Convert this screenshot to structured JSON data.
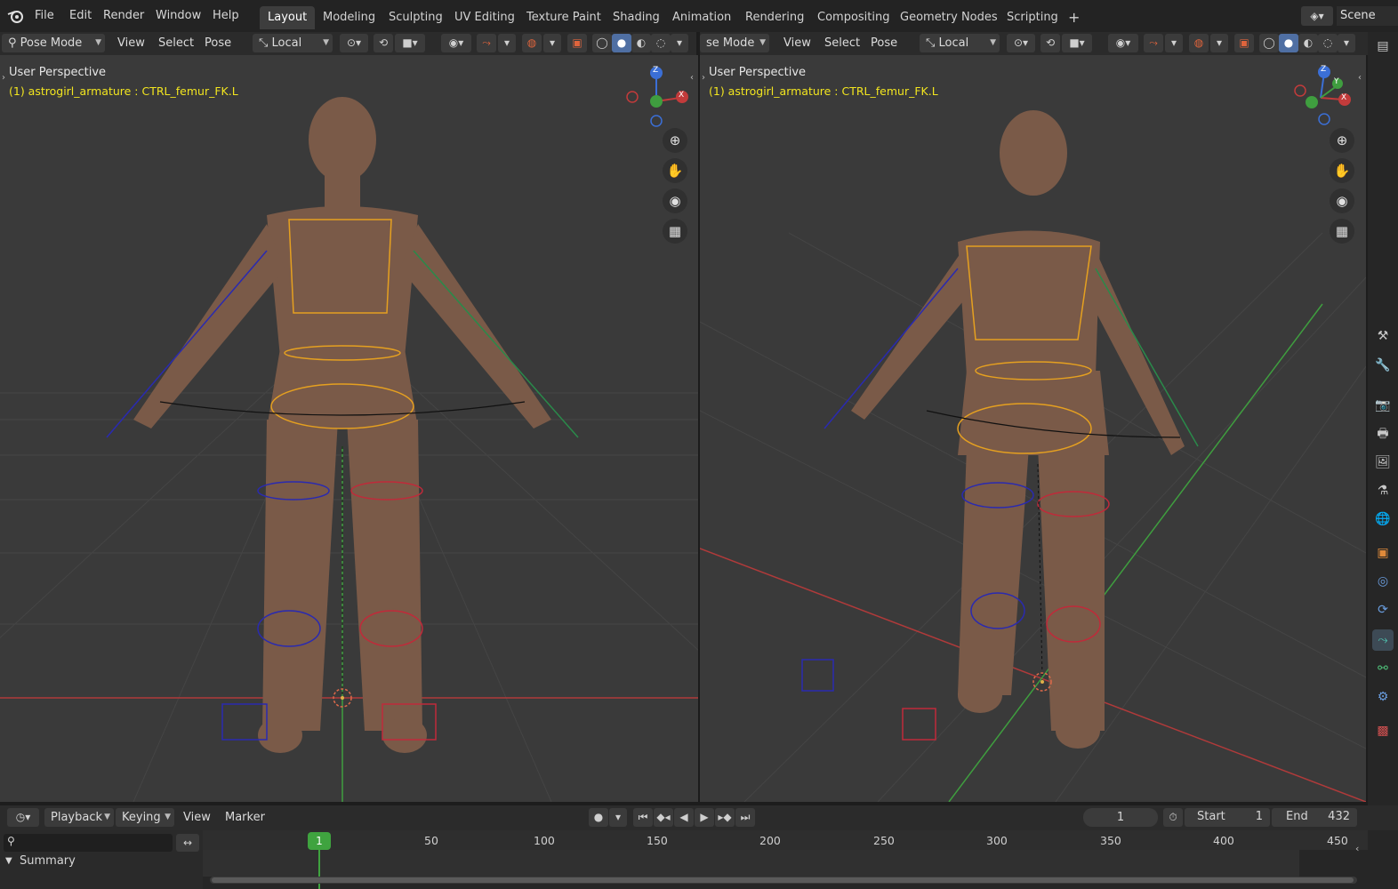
{
  "app": {
    "logo": "blender-logo-icon"
  },
  "menus": [
    "File",
    "Edit",
    "Render",
    "Window",
    "Help"
  ],
  "workspaces": [
    "Layout",
    "Modeling",
    "Sculpting",
    "UV Editing",
    "Texture Paint",
    "Shading",
    "Animation",
    "Rendering",
    "Compositing",
    "Geometry Nodes",
    "Scripting"
  ],
  "active_workspace": "Layout",
  "add_workspace": "+",
  "scene_name": "Scene",
  "left_header": {
    "mode": "Pose Mode",
    "view": "View",
    "select": "Select",
    "pose": "Pose",
    "orientation": "Local"
  },
  "right_header": {
    "mode": "se Mode",
    "view": "View",
    "select": "Select",
    "pose": "Pose",
    "orientation": "Local"
  },
  "left_viewport": {
    "title": "User Perspective",
    "object": "(1) astrogirl_armature : CTRL_femur_FK.L"
  },
  "right_viewport": {
    "title": "User Perspective",
    "object": "(1) astrogirl_armature : CTRL_femur_FK.L"
  },
  "gizmo": {
    "z": "Z",
    "x": "X",
    "y": "Y"
  },
  "timeline": {
    "playback": "Playback",
    "keying": "Keying",
    "view": "View",
    "marker": "Marker",
    "current_frame": "1",
    "start_label": "Start",
    "start": "1",
    "end_label": "End",
    "end": "432",
    "summary": "Summary",
    "current_frame_marker": "1",
    "ruler": [
      "50",
      "100",
      "150",
      "200",
      "250",
      "300",
      "350",
      "400",
      "450"
    ]
  },
  "colors": {
    "accent": "#4f6fa3",
    "object_text": "#f2e51f",
    "frame_green": "#3fa33f",
    "x_axis": "#c23b3b",
    "y_axis": "#3f9e3f",
    "z_axis": "#3b6fd6"
  }
}
